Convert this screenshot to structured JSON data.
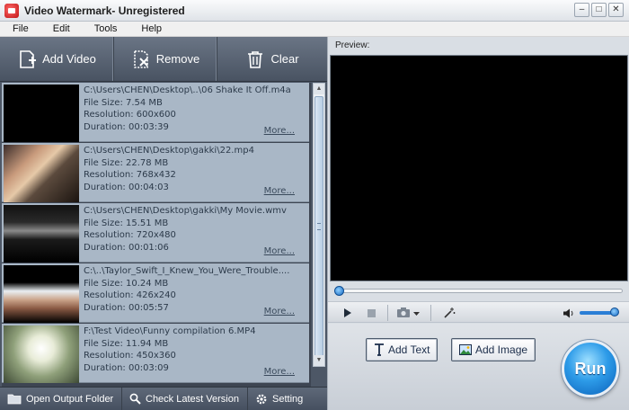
{
  "window": {
    "title": "Video Watermark- Unregistered",
    "buttons": {
      "minimize": "–",
      "maximize": "□",
      "close": "✕"
    }
  },
  "menu": [
    "File",
    "Edit",
    "Tools",
    "Help"
  ],
  "toolbar": {
    "add_video": "Add Video",
    "remove": "Remove",
    "clear": "Clear"
  },
  "files": [
    {
      "path": "C:\\Users\\CHEN\\Desktop\\..\\06 Shake It Off.m4a",
      "size": "File Size: 7.54 MB",
      "resolution": "Resolution: 600x600",
      "duration": "Duration: 00:03:39",
      "more": "More..."
    },
    {
      "path": "C:\\Users\\CHEN\\Desktop\\gakki\\22.mp4",
      "size": "File Size: 22.78 MB",
      "resolution": "Resolution: 768x432",
      "duration": "Duration: 00:04:03",
      "more": "More..."
    },
    {
      "path": "C:\\Users\\CHEN\\Desktop\\gakki\\My Movie.wmv",
      "size": "File Size: 15.51 MB",
      "resolution": "Resolution: 720x480",
      "duration": "Duration: 00:01:06",
      "more": "More..."
    },
    {
      "path": "C:\\..\\Taylor_Swift_I_Knew_You_Were_Trouble....",
      "size": "File Size: 10.24 MB",
      "resolution": "Resolution: 426x240",
      "duration": "Duration: 00:05:57",
      "more": "More..."
    },
    {
      "path": "F:\\Test Video\\Funny compilation 6.MP4",
      "size": "File Size: 11.94 MB",
      "resolution": "Resolution: 450x360",
      "duration": "Duration: 00:03:09",
      "more": "More..."
    }
  ],
  "bottombar": {
    "open_output": "Open Output Folder",
    "check_version": "Check Latest Version",
    "setting": "Setting"
  },
  "preview": {
    "label": "Preview:",
    "progress": 0.0,
    "volume": 1.0
  },
  "actions": {
    "add_text": "Add Text",
    "add_image": "Add Image",
    "run": "Run"
  },
  "colors": {
    "accent": "#1769c2",
    "toolbar_bg": "#4d5766",
    "list_item_bg": "#a9b7c6"
  }
}
